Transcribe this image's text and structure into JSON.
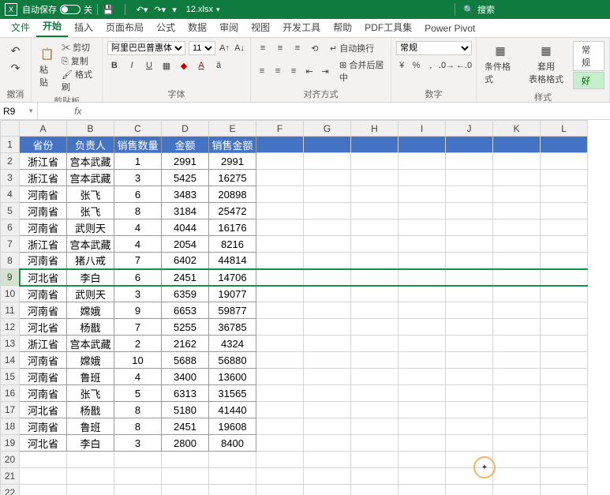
{
  "titlebar": {
    "autosave_label": "自动保存",
    "autosave_state": "关",
    "filename": "12.xlsx",
    "search_placeholder": "搜索"
  },
  "tabs": {
    "file": "文件",
    "home": "开始",
    "insert": "插入",
    "layout": "页面布局",
    "formulas": "公式",
    "data": "数据",
    "review": "审阅",
    "view": "视图",
    "developer": "开发工具",
    "help": "帮助",
    "pdf": "PDF工具集",
    "powerpivot": "Power Pivot"
  },
  "ribbon": {
    "undo": "撤消",
    "paste": "粘贴",
    "cut": "剪切",
    "copy": "复制",
    "format_painter": "格式刷",
    "clipboard": "剪贴板",
    "font_name": "阿里巴巴普惠体",
    "font_size": "11",
    "font": "字体",
    "alignment": "对齐方式",
    "wrap": "自动换行",
    "merge": "合并后居中",
    "number_format": "常规",
    "number": "数字",
    "cond_format": "条件格式",
    "table_format": "套用\n表格格式",
    "cell_style_normal": "常规",
    "cell_style_good": "好",
    "styles": "样式"
  },
  "formula_bar": {
    "cell_ref": "R9"
  },
  "columns": [
    "A",
    "B",
    "C",
    "D",
    "E",
    "F",
    "G",
    "H",
    "I",
    "J",
    "K",
    "L"
  ],
  "row_count": 22,
  "selected_row": 9,
  "chart_data": {
    "type": "table",
    "headers": [
      "省份",
      "负责人",
      "销售数量",
      "金额",
      "销售金额"
    ],
    "rows": [
      [
        "浙江省",
        "宫本武藏",
        1,
        2991,
        2991
      ],
      [
        "浙江省",
        "宫本武藏",
        3,
        5425,
        16275
      ],
      [
        "河南省",
        "张飞",
        6,
        3483,
        20898
      ],
      [
        "河南省",
        "张飞",
        8,
        3184,
        25472
      ],
      [
        "河南省",
        "武则天",
        4,
        4044,
        16176
      ],
      [
        "浙江省",
        "宫本武藏",
        4,
        2054,
        8216
      ],
      [
        "河南省",
        "猪八戒",
        7,
        6402,
        44814
      ],
      [
        "河北省",
        "李白",
        6,
        2451,
        14706
      ],
      [
        "河南省",
        "武则天",
        3,
        6359,
        19077
      ],
      [
        "河南省",
        "嫦娥",
        9,
        6653,
        59877
      ],
      [
        "河北省",
        "杨戬",
        7,
        5255,
        36785
      ],
      [
        "浙江省",
        "宫本武藏",
        2,
        2162,
        4324
      ],
      [
        "河南省",
        "嫦娥",
        10,
        5688,
        56880
      ],
      [
        "河南省",
        "鲁班",
        4,
        3400,
        13600
      ],
      [
        "河南省",
        "张飞",
        5,
        6313,
        31565
      ],
      [
        "河北省",
        "杨戬",
        8,
        5180,
        41440
      ],
      [
        "河南省",
        "鲁班",
        8,
        2451,
        19608
      ],
      [
        "河北省",
        "李白",
        3,
        2800,
        8400
      ]
    ]
  }
}
